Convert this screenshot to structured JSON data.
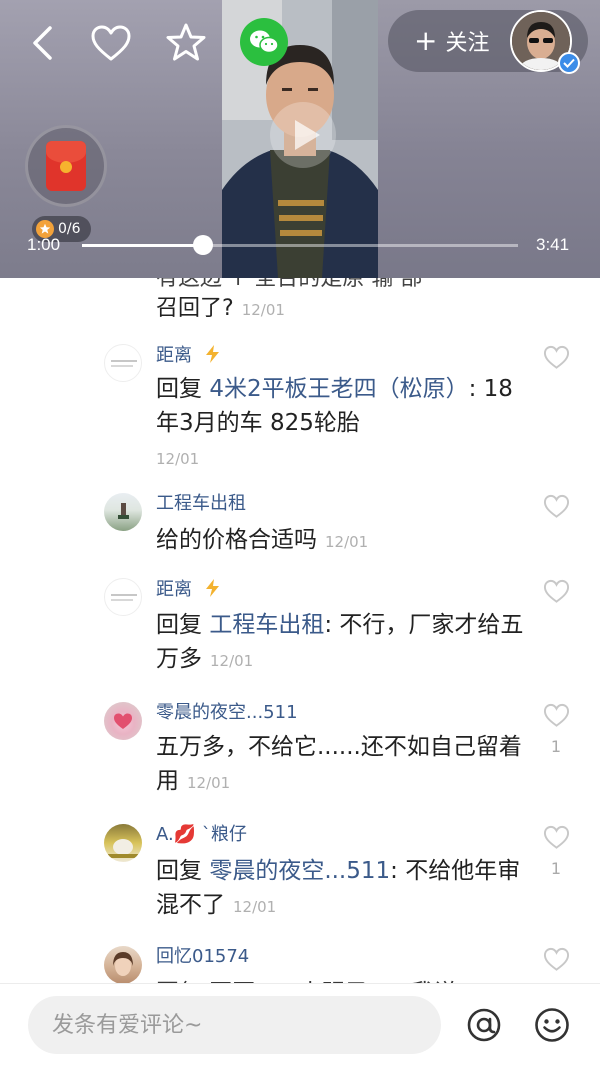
{
  "header": {
    "follow_label": "关注",
    "redpacket_count": "0/6",
    "time_current": "1:00",
    "time_total": "3:41",
    "progress_fraction": 0.277
  },
  "comments": {
    "partial_top": {
      "text_fragment": "召回了?",
      "time": "12/01"
    },
    "items": [
      {
        "author": "距离",
        "author_badge": "lightning-icon",
        "reply_prefix": "回复",
        "reply_target": "4米2平板王老四（松原）",
        "text": ": 18年3月的车 825轮胎",
        "time": "12/01",
        "likes": ""
      },
      {
        "author": "工程车出租",
        "text": "给的价格合适吗",
        "time": "12/01",
        "likes": ""
      },
      {
        "author": "距离",
        "author_badge": "lightning-icon",
        "reply_prefix": "回复",
        "reply_target": "工程车出租",
        "text": ": 不行，厂家才给五万多",
        "time": "12/01",
        "likes": ""
      },
      {
        "author": "零晨的夜空...511",
        "text": "五万多，不给它......还不如自己留着用",
        "time": "12/01",
        "likes": "1"
      },
      {
        "author": "A.💋 `粮仔",
        "reply_prefix": "回复",
        "reply_target": "零晨的夜空...511",
        "text": ": 不给他年审混不了",
        "time": "12/01",
        "likes": "1"
      },
      {
        "author": "回忆01574",
        "text": "",
        "time": "",
        "likes": ""
      }
    ]
  },
  "bottom": {
    "input_placeholder": "发条有爱评论~"
  },
  "colors": {
    "name_link": "#3b5a8a",
    "wechat_green": "#2bbf3f",
    "heart_gray": "#c8c8c8"
  }
}
